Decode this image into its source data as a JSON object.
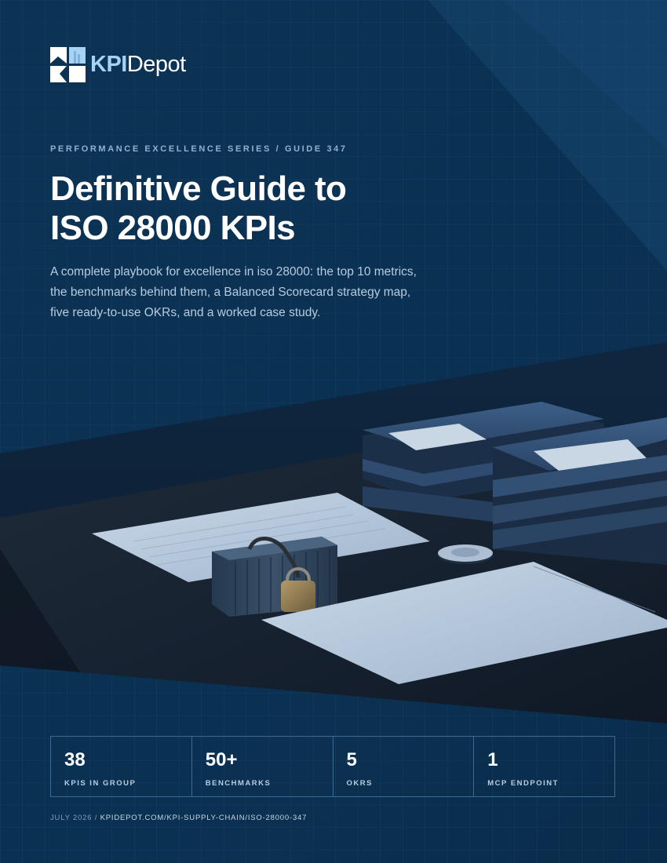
{
  "brand": {
    "name_part1": "KPI",
    "name_part2": "Depot"
  },
  "cover": {
    "series_label": "PERFORMANCE EXCELLENCE SERIES / GUIDE 347",
    "title_line1": "Definitive Guide to",
    "title_line2": "ISO 28000 KPIs",
    "subtitle": "A complete playbook for excellence in iso 28000: the top 10 metrics, the benchmarks behind them, a Balanced Scorecard strategy map, five ready-to-use OKRs, and a worked case study."
  },
  "stats": [
    {
      "value": "38",
      "label": "KPIS IN GROUP"
    },
    {
      "value": "50+",
      "label": "BENCHMARKS"
    },
    {
      "value": "5",
      "label": "OKRS"
    },
    {
      "value": "1",
      "label": "MCP ENDPOINT"
    }
  ],
  "footer": {
    "date": "JULY 2026",
    "separator": " / ",
    "url": "KPIDEPOT.COM/KPI-SUPPLY-CHAIN/ISO-28000-347"
  },
  "colors": {
    "background": "#0d3356",
    "accent": "#a6d2f4",
    "text_primary": "#ffffff",
    "text_muted": "#b7cbe0"
  },
  "photo": {
    "subject": "shipping container padlocked on a desk with binders and documents"
  }
}
